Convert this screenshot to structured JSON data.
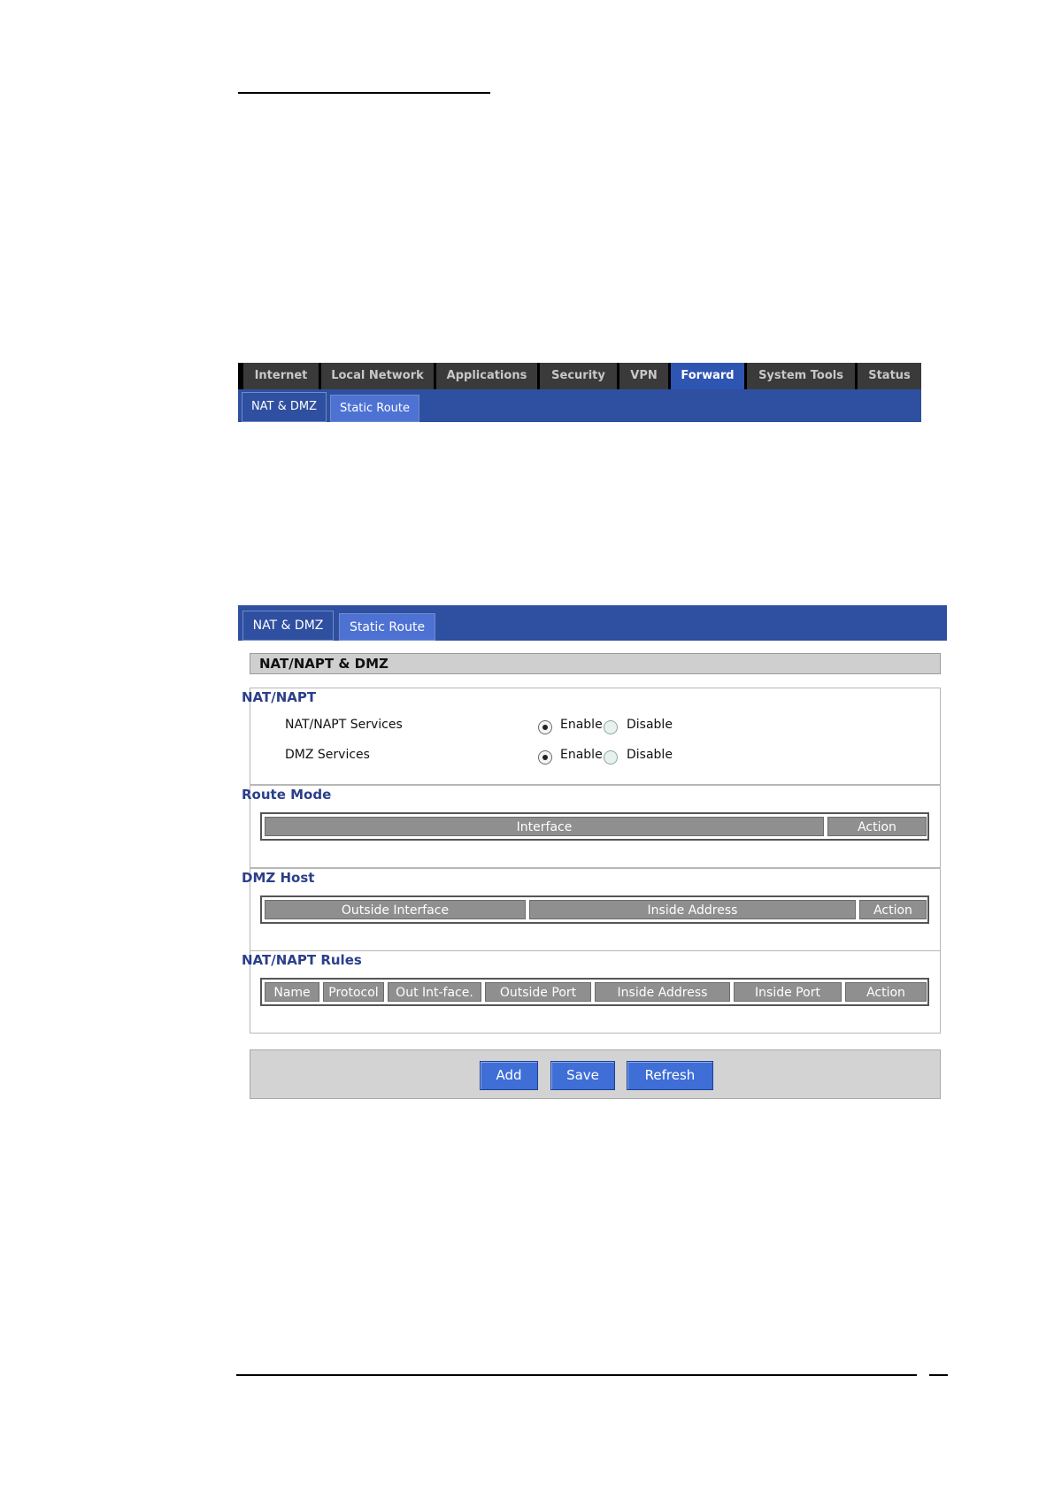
{
  "top_nav": {
    "tabs": [
      {
        "label": "Internet"
      },
      {
        "label": "Local Network"
      },
      {
        "label": "Applications"
      },
      {
        "label": "Security"
      },
      {
        "label": "VPN"
      },
      {
        "label": "Forward",
        "active": true
      },
      {
        "label": "System Tools"
      },
      {
        "label": "Status"
      }
    ],
    "subtabs": [
      {
        "label": "NAT & DMZ",
        "selected": true
      },
      {
        "label": "Static Route"
      }
    ]
  },
  "panel": {
    "subtabs": [
      {
        "label": "NAT & DMZ",
        "selected": true
      },
      {
        "label": "Static Route"
      }
    ],
    "section_title": "NAT/NAPT & DMZ",
    "nat_napt": {
      "title": "NAT/NAPT",
      "rows": [
        {
          "label": "NAT/NAPT Services",
          "enable_label": "Enable",
          "disable_label": "Disable",
          "value": "Enable"
        },
        {
          "label": "DMZ Services",
          "enable_label": "Enable",
          "disable_label": "Disable",
          "value": "Enable"
        }
      ]
    },
    "route_mode": {
      "title": "Route Mode",
      "columns": [
        "Interface",
        "Action"
      ]
    },
    "dmz_host": {
      "title": "DMZ Host",
      "columns": [
        "Outside Interface",
        "Inside Address",
        "Action"
      ]
    },
    "nat_rules": {
      "title": "NAT/NAPT Rules",
      "columns": [
        "Name",
        "Protocol",
        "Out Int-face.",
        "Outside Port",
        "Inside Address",
        "Inside Port",
        "Action"
      ]
    },
    "buttons": {
      "add": "Add",
      "save": "Save",
      "refresh": "Refresh"
    }
  },
  "colors": {
    "nav_blue": "#2f4fa0",
    "tab_active": "#2f55b3",
    "button_blue": "#3e6ed6",
    "header_grey": "#8f8f8f",
    "group_title": "#2b3f8a"
  }
}
